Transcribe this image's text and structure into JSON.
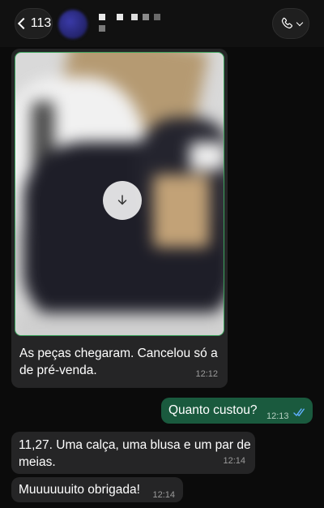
{
  "header": {
    "back_count": "113",
    "back_icon": "chevron-left-icon",
    "call_icon": "phone-icon"
  },
  "messages": [
    {
      "type": "photo",
      "direction": "incoming",
      "caption": "As peças chegaram. Cancelou só a de pré-venda",
      "caption_line1": "As peças chegaram. Cancelou só a",
      "caption_line2": "de pré-venda.",
      "time": "12:12"
    },
    {
      "direction": "outgoing",
      "text": "Quanto custou?",
      "time": "12:13"
    },
    {
      "direction": "incoming",
      "text_line1": "11,27. Uma calça, uma blusa e um par de",
      "text_line2": "meias.",
      "time": "12:14"
    },
    {
      "direction": "incoming",
      "text": "Muuuuuuito obrigada!",
      "time": "12:14"
    }
  ],
  "colors": {
    "background": "#0b0b0b",
    "incoming_bubble": "#252526",
    "outgoing_bubble": "#1a5a3e",
    "read_ticks": "#5fb0ff"
  }
}
